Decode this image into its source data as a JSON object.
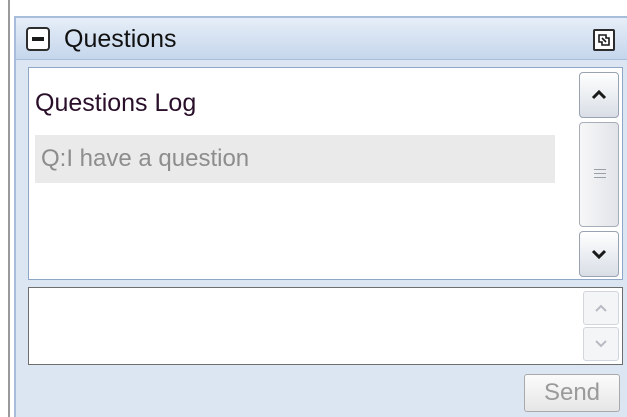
{
  "panel": {
    "title": "Questions",
    "icons": {
      "collapse": "collapse-minus-icon",
      "popout": "popout-window-icon"
    }
  },
  "log": {
    "heading": "Questions Log",
    "entries": [
      {
        "text": "Q:I have a question"
      }
    ],
    "scroll_icons": {
      "up": "chevron-up-icon",
      "down": "chevron-down-icon",
      "thumb": "scroll-grip-icon"
    }
  },
  "compose": {
    "value": "",
    "placeholder": "",
    "send_label": "Send"
  },
  "colors": {
    "panel_bg": "#dce6f2",
    "panel_border": "#a7bdd9",
    "heading_text": "#2a0f2a",
    "entry_bg": "#eaeaea",
    "entry_text": "#8d8d8d",
    "disabled_text": "#9a9a9a"
  }
}
